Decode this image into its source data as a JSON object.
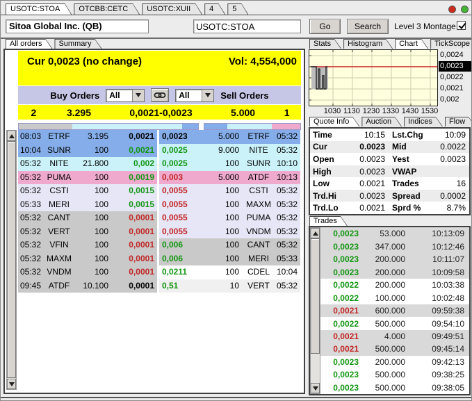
{
  "window": {
    "tabs": [
      {
        "label": "USOTC:STOA",
        "active": true
      },
      {
        "label": "OTCBB:CETC",
        "active": false
      },
      {
        "label": "USOTC:XUII",
        "active": false
      },
      {
        "label": "4",
        "active": false
      },
      {
        "label": "5",
        "active": false
      }
    ],
    "status_dots": [
      {
        "name": "red",
        "color": "#cc2b1c"
      },
      {
        "name": "green",
        "color": "#46b535"
      }
    ]
  },
  "header": {
    "company": "Sitoa Global Inc. (QB)",
    "symbol_value": "USOTC:STOA",
    "go_label": "Go",
    "search_label": "Search",
    "montage_label": "Level 3 Montage",
    "montage_checked": true
  },
  "left_panel": {
    "tabs": [
      {
        "label": "All orders",
        "active": true
      },
      {
        "label": "Summary",
        "active": false
      }
    ],
    "cur_line": "Cur 0,0023 (no change)",
    "vol_line": "Vol: 4,554,000",
    "filter": {
      "buy_label": "Buy Orders",
      "buy_value": "All",
      "sell_value": "All",
      "sell_label": "Sell Orders"
    },
    "totals": {
      "buy_count": "2",
      "buy_size": "3.295",
      "price_range": "0,0021-0,0023",
      "sell_size": "5.000",
      "sell_count": "1"
    },
    "depth_left": [
      {
        "color": "#c9c9c9",
        "width": "30%"
      },
      {
        "color": "#cbf2f9",
        "width": "61%"
      },
      {
        "color": "#85ade9",
        "width": "9%"
      }
    ],
    "depth_right": [
      {
        "color": "#85ade9",
        "width": "24%"
      },
      {
        "color": "#cbf2f9",
        "width": "46%"
      },
      {
        "color": "#efa9cd",
        "width": "30%"
      }
    ],
    "book": [
      {
        "bt": "08:03",
        "bm": "ETRF",
        "bs": "3.195",
        "bp": "0,0021",
        "bpc": "#000000",
        "bbg": "#85ade9",
        "sp": "0,0023",
        "spc": "#000000",
        "ss": "5.000",
        "sm": "ETRF",
        "st": "05:32",
        "sbg": "#85ade9"
      },
      {
        "bt": "10:04",
        "bm": "SUNR",
        "bs": "100",
        "bp": "0,0021",
        "bpc": "#129612",
        "bbg": "#85ade9",
        "sp": "0,0025",
        "spc": "#129612",
        "ss": "9.000",
        "sm": "NITE",
        "st": "05:32",
        "sbg": "#cbf2f9"
      },
      {
        "bt": "05:32",
        "bm": "NITE",
        "bs": "21.800",
        "bp": "0,002",
        "bpc": "#129612",
        "bbg": "#cbf2f9",
        "sp": "0,0025",
        "spc": "#129612",
        "ss": "100",
        "sm": "SUNR",
        "st": "10:10",
        "sbg": "#cbf2f9"
      },
      {
        "bt": "05:32",
        "bm": "PUMA",
        "bs": "100",
        "bp": "0,0019",
        "bpc": "#129612",
        "bbg": "#efa9cd",
        "sp": "0,003",
        "spc": "#c22525",
        "ss": "5.000",
        "sm": "ATDF",
        "st": "10:13",
        "sbg": "#efa9cd"
      },
      {
        "bt": "05:32",
        "bm": "CSTI",
        "bs": "100",
        "bp": "0,0015",
        "bpc": "#129612",
        "bbg": "#e6e6f6",
        "sp": "0,0055",
        "spc": "#c22525",
        "ss": "100",
        "sm": "CSTI",
        "st": "05:32",
        "sbg": "#e6e6f6"
      },
      {
        "bt": "05:33",
        "bm": "MERI",
        "bs": "100",
        "bp": "0,0015",
        "bpc": "#129612",
        "bbg": "#e6e6f6",
        "sp": "0,0055",
        "spc": "#c22525",
        "ss": "100",
        "sm": "MAXM",
        "st": "05:32",
        "sbg": "#e6e6f6"
      },
      {
        "bt": "05:32",
        "bm": "CANT",
        "bs": "100",
        "bp": "0,0001",
        "bpc": "#c22525",
        "bbg": "#c9c9c9",
        "sp": "0,0055",
        "spc": "#c22525",
        "ss": "100",
        "sm": "PUMA",
        "st": "05:32",
        "sbg": "#e6e6f6"
      },
      {
        "bt": "05:32",
        "bm": "VERT",
        "bs": "100",
        "bp": "0,0001",
        "bpc": "#c22525",
        "bbg": "#c9c9c9",
        "sp": "0,0055",
        "spc": "#c22525",
        "ss": "100",
        "sm": "VNDM",
        "st": "05:32",
        "sbg": "#e6e6f6"
      },
      {
        "bt": "05:32",
        "bm": "VFIN",
        "bs": "100",
        "bp": "0,0001",
        "bpc": "#c22525",
        "bbg": "#c9c9c9",
        "sp": "0,006",
        "spc": "#129612",
        "ss": "100",
        "sm": "CANT",
        "st": "05:32",
        "sbg": "#c9c9c9"
      },
      {
        "bt": "05:32",
        "bm": "MAXM",
        "bs": "100",
        "bp": "0,0001",
        "bpc": "#c22525",
        "bbg": "#c9c9c9",
        "sp": "0,006",
        "spc": "#129612",
        "ss": "100",
        "sm": "MERI",
        "st": "05:33",
        "sbg": "#c9c9c9"
      },
      {
        "bt": "05:32",
        "bm": "VNDM",
        "bs": "100",
        "bp": "0,0001",
        "bpc": "#c22525",
        "bbg": "#c9c9c9",
        "sp": "0,0211",
        "spc": "#129612",
        "ss": "100",
        "sm": "CDEL",
        "st": "10:04",
        "sbg": "#ffffff"
      },
      {
        "bt": "09:45",
        "bm": "ATDF",
        "bs": "10.100",
        "bp": "0,0001",
        "bpc": "#000000",
        "bbg": "#c9c9c9",
        "sp": "0,51",
        "spc": "#129612",
        "ss": "10",
        "sm": "VERT",
        "st": "05:32",
        "sbg": "#f0f0f0"
      }
    ]
  },
  "right_panel": {
    "chart_tabs": [
      {
        "label": "Stats",
        "active": false
      },
      {
        "label": "Histogram",
        "active": false
      },
      {
        "label": "Chart",
        "active": true
      },
      {
        "label": "TickScope",
        "active": false
      }
    ],
    "chart": {
      "type": "line",
      "y_ticks": [
        "0,0024",
        "0,0023",
        "0,0022",
        "0,0021",
        "0,002"
      ],
      "current_price_tick": "0,0023",
      "x_ticks": [
        "1030",
        "1130",
        "1230",
        "1330",
        "1430",
        "1530"
      ],
      "red_line_price": 0.0023,
      "band": {
        "x1": 3,
        "x2": 27,
        "top": 0.0023,
        "bottom": 0.0021
      },
      "trace": [
        [
          2,
          0.0023
        ],
        [
          10,
          0.0023
        ],
        [
          10,
          0.0021
        ],
        [
          13,
          0.0021
        ],
        [
          13,
          0.00228
        ],
        [
          15,
          0.00228
        ],
        [
          15,
          0.0021
        ],
        [
          19,
          0.0021
        ],
        [
          19,
          0.00222
        ],
        [
          21,
          0.00222
        ],
        [
          21,
          0.0021
        ],
        [
          24,
          0.0021
        ],
        [
          24,
          0.0023
        ],
        [
          26,
          0.0023
        ]
      ],
      "band_color": "#bdbdbd",
      "line_color": "#222222",
      "red_line_color": "#cc2222",
      "bg_color": "#ffffdd"
    },
    "quote_tabs": [
      {
        "label": "Quote Info",
        "active": true
      },
      {
        "label": "Auction",
        "active": false
      },
      {
        "label": "Indices",
        "active": false
      },
      {
        "label": "Flow",
        "active": false
      }
    ],
    "quote_rows": [
      {
        "l1": "Time",
        "v1": "10:15",
        "l2": "Lst.Chg",
        "v2": "10:09"
      },
      {
        "l1": "Cur",
        "v1": "0.0023",
        "l2": "Mid",
        "v2": "0.0022"
      },
      {
        "l1": "Open",
        "v1": "0.0023",
        "l2": "Yest",
        "v2": "0.0023"
      },
      {
        "l1": "High",
        "v1": "0.0023",
        "l2": "VWAP",
        "v2": ""
      },
      {
        "l1": "Low",
        "v1": "0.0021",
        "l2": "Trades",
        "v2": "16"
      },
      {
        "l1": "Trd.Hi",
        "v1": "0.0023",
        "l2": "Spread",
        "v2": "0.0002"
      },
      {
        "l1": "Trd.Lo",
        "v1": "0.0021",
        "l2": "Sprd %",
        "v2": "8.7%"
      }
    ],
    "trades_tab": "Trades",
    "trades": [
      {
        "price": "0,0023",
        "size": "53.000",
        "time": "10:13:09",
        "color": "#129612",
        "bg": "#d9d9d9"
      },
      {
        "price": "0,0023",
        "size": "347.000",
        "time": "10:12:46",
        "color": "#129612",
        "bg": "#d9d9d9"
      },
      {
        "price": "0,0023",
        "size": "200.000",
        "time": "10:11:07",
        "color": "#129612",
        "bg": "#d9d9d9"
      },
      {
        "price": "0,0023",
        "size": "200.000",
        "time": "10:09:58",
        "color": "#129612",
        "bg": "#d9d9d9"
      },
      {
        "price": "0,0022",
        "size": "200.000",
        "time": "10:03:38",
        "color": "#129612",
        "bg": "#ffffff"
      },
      {
        "price": "0,0022",
        "size": "100.000",
        "time": "10:02:48",
        "color": "#129612",
        "bg": "#ffffff"
      },
      {
        "price": "0,0021",
        "size": "600.000",
        "time": "09:59:38",
        "color": "#c22525",
        "bg": "#d9d9d9"
      },
      {
        "price": "0,0022",
        "size": "500.000",
        "time": "09:54:10",
        "color": "#129612",
        "bg": "#ffffff"
      },
      {
        "price": "0,0021",
        "size": "4.000",
        "time": "09:49:51",
        "color": "#c22525",
        "bg": "#d9d9d9"
      },
      {
        "price": "0,0021",
        "size": "500.000",
        "time": "09:45:14",
        "color": "#c22525",
        "bg": "#d9d9d9"
      },
      {
        "price": "0,0023",
        "size": "200.000",
        "time": "09:42:13",
        "color": "#129612",
        "bg": "#ffffff"
      },
      {
        "price": "0,0023",
        "size": "500.000",
        "time": "09:38:25",
        "color": "#129612",
        "bg": "#ffffff"
      },
      {
        "price": "0,0023",
        "size": "500.000",
        "time": "09:38:05",
        "color": "#129612",
        "bg": "#ffffff"
      }
    ]
  },
  "colors": {
    "yellow_header": "#ffff00",
    "filter_bar": "#c6c6e6",
    "row_blue": "#85ade9",
    "row_cyan": "#cbf2f9",
    "row_pink": "#efa9cd",
    "row_lavender": "#e6e6f6",
    "row_gray": "#c9c9c9",
    "green_text": "#129612",
    "red_text": "#c22525"
  }
}
